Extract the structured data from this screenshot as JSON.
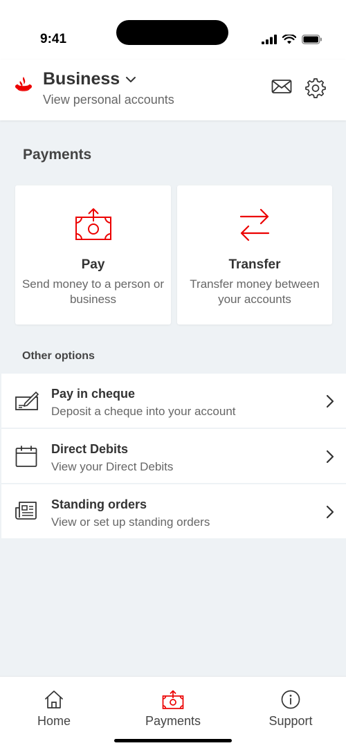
{
  "status_bar": {
    "time": "9:41"
  },
  "header": {
    "title": "Business",
    "subtitle": "View personal accounts",
    "logo_icon": "flame-logo",
    "icons": [
      "mail-icon",
      "gear-icon"
    ]
  },
  "colors": {
    "brand_red": "#ec0000",
    "background": "#eef2f5",
    "text": "#333333",
    "muted": "#666666"
  },
  "payments": {
    "title": "Payments",
    "cards": [
      {
        "title": "Pay",
        "desc": "Send money to a person or business",
        "icon": "send-money-icon"
      },
      {
        "title": "Transfer",
        "desc": "Transfer money between your accounts",
        "icon": "transfer-arrows-icon"
      }
    ]
  },
  "other": {
    "title": "Other options",
    "items": [
      {
        "title": "Pay in cheque",
        "desc": "Deposit a cheque into your account",
        "icon": "cheque-icon"
      },
      {
        "title": "Direct Debits",
        "desc": "View your Direct Debits",
        "icon": "calendar-icon"
      },
      {
        "title": "Standing orders",
        "desc": "View or set up standing orders",
        "icon": "standing-order-icon"
      }
    ]
  },
  "nav": {
    "items": [
      {
        "label": "Home",
        "icon": "home-icon"
      },
      {
        "label": "Payments",
        "icon": "payments-icon",
        "active": true
      },
      {
        "label": "Support",
        "icon": "info-icon"
      }
    ]
  }
}
